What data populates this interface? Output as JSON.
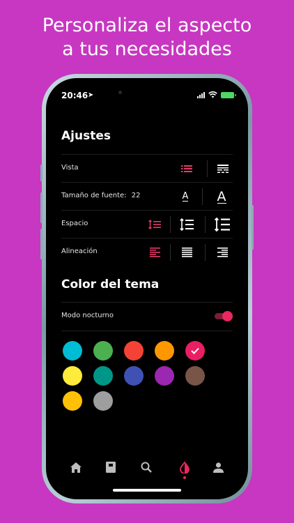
{
  "headline": {
    "line1": "Personaliza el aspecto",
    "line2": "a tus necesidades"
  },
  "status": {
    "time": "20:46"
  },
  "settings": {
    "title": "Ajustes",
    "rows": [
      {
        "label": "Vista"
      },
      {
        "label": "Tamaño de fuente:",
        "value": "22"
      },
      {
        "label": "Espacio"
      },
      {
        "label": "Alineación"
      }
    ]
  },
  "theme": {
    "title": "Color del tema",
    "night_mode_label": "Modo nocturno",
    "night_mode_on": true,
    "colors": [
      "#00bcd4",
      "#4caf50",
      "#f44336",
      "#ff9800",
      "#e91e63",
      "#ffeb3b",
      "#009688",
      "#3f51b5",
      "#9c27b0",
      "#795548",
      "#ffc107",
      "#9e9e9e"
    ],
    "selected_index": 4
  },
  "tabbar": {
    "active": "theme"
  },
  "colors": {
    "accent": "#e53a68",
    "background": "#c737c1"
  }
}
